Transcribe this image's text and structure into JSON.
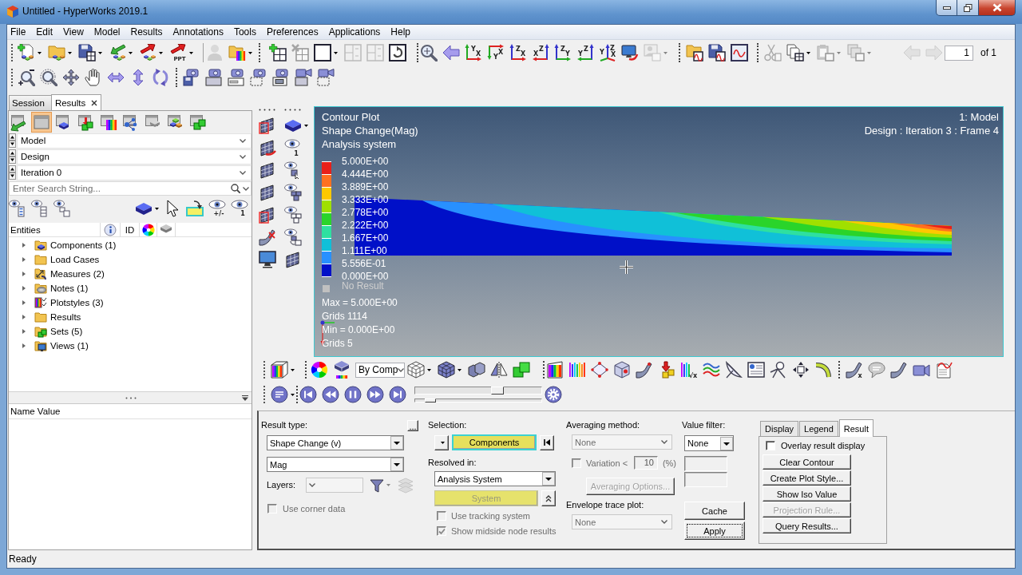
{
  "window": {
    "title": "Untitled - HyperWorks 2019.1"
  },
  "menu": [
    "File",
    "Edit",
    "View",
    "Model",
    "Results",
    "Annotations",
    "Tools",
    "Preferences",
    "Applications",
    "Help"
  ],
  "main_toolbar": {
    "row_1": [
      [
        {
          "disabled": false
        },
        {
          "disabled": false
        },
        {
          "disabled": false
        },
        {
          "disabled": false
        },
        {
          "disabled": false
        },
        {
          "disabled": false,
          "label": "PPT"
        }
      ],
      [
        {
          "disabled": true
        },
        {
          "disabled": false
        }
      ],
      [
        {
          "disabled": false
        },
        {
          "disabled": true
        },
        {
          "disabled": false
        },
        {
          "disabled": true
        },
        {
          "disabled": true
        },
        {
          "disabled": false
        }
      ],
      [
        {
          "disabled": false
        },
        {
          "disabled": false
        },
        {
          "disabled": false,
          "axes": [
            "Y",
            "X"
          ]
        },
        {
          "disabled": false,
          "axes": [
            "X",
            "Y"
          ]
        },
        {
          "disabled": false,
          "axes": [
            "Z",
            "X"
          ]
        },
        {
          "disabled": false,
          "axes": [
            "X",
            "Z"
          ]
        },
        {
          "disabled": false,
          "axes": [
            "Z",
            "Y"
          ]
        },
        {
          "disabled": false,
          "axes": [
            "Y",
            "Z"
          ]
        },
        {
          "disabled": false,
          "axes": [
            "Y",
            "Z",
            "X"
          ]
        },
        {
          "disabled": false
        },
        {
          "disabled": true
        }
      ],
      [
        {
          "disabled": false
        },
        {
          "disabled": false
        },
        {
          "disabled": false
        }
      ],
      [
        {
          "disabled": true
        },
        {
          "disabled": false
        },
        {
          "disabled": true
        },
        {
          "disabled": true
        }
      ]
    ],
    "page_nav": [
      {
        "disabled": true
      },
      {
        "disabled": true
      }
    ],
    "page": {
      "value": "1",
      "total": "of 1"
    },
    "row_2": [
      [
        {
          "disabled": false
        },
        {
          "disabled": false
        },
        {
          "disabled": false
        },
        {
          "disabled": false
        },
        {
          "disabled": false
        },
        {
          "disabled": false
        },
        {
          "disabled": false
        }
      ],
      [
        {
          "disabled": false
        },
        {
          "disabled": false
        },
        {
          "disabled": false
        },
        {
          "disabled": false
        },
        {
          "disabled": false
        },
        {
          "disabled": false
        },
        {
          "disabled": false
        }
      ]
    ]
  },
  "browser": {
    "tabs": [
      {
        "label": "Session",
        "selected": false,
        "closable": false
      },
      {
        "label": "Results",
        "selected": true,
        "closable": true
      }
    ],
    "tools": [
      {
        "selected": false
      },
      {
        "selected": true
      },
      {
        "selected": false
      },
      {
        "selected": false
      },
      {
        "selected": false
      },
      {
        "selected": false
      },
      {
        "selected": false
      },
      {
        "selected": false
      },
      {
        "selected": false
      }
    ],
    "selectors": [
      {
        "value": "Model"
      },
      {
        "value": "Design"
      },
      {
        "value": "Iteration 0"
      }
    ],
    "search": {
      "placeholder": "Enter Search String..."
    },
    "filter_tools": {
      "toggle_badge": "+/-",
      "single_badge": "1"
    },
    "columns": [
      {
        "kind": "text",
        "label": "Entities"
      },
      {
        "kind": "icon"
      },
      {
        "kind": "text",
        "label": "ID"
      },
      {
        "kind": "icon"
      },
      {
        "kind": "icon"
      }
    ],
    "tree": [
      {
        "label": "Components (1)",
        "expanded": false
      },
      {
        "label": "Load Cases",
        "expanded": false
      },
      {
        "label": "Measures (2)",
        "expanded": false
      },
      {
        "label": "Notes (1)",
        "expanded": false
      },
      {
        "label": "Plotstyles (3)",
        "expanded": false
      },
      {
        "label": "Results",
        "expanded": false
      },
      {
        "label": "Sets (5)",
        "expanded": false
      },
      {
        "label": "Views (1)",
        "expanded": false
      }
    ],
    "properties": {
      "header": "Name Value"
    }
  },
  "view_tools": {
    "eye_badge": "1"
  },
  "viewport": {
    "title_lines": [
      "Contour Plot",
      "Shape Change(Mag)",
      "Analysis system"
    ],
    "model_label": "1: Model",
    "frame_label": "Design : Iteration 3 : Frame 4",
    "legend": {
      "labels": [
        "5.000E+00",
        "4.444E+00",
        "3.889E+00",
        "3.333E+00",
        "2.778E+00",
        "2.222E+00",
        "1.667E+00",
        "1.111E+00",
        "5.556E-01",
        "0.000E+00"
      ],
      "bands": [
        {
          "color": "#e8201a"
        },
        {
          "color": "#ff7020"
        },
        {
          "color": "#ffc800"
        },
        {
          "color": "#a0e000"
        },
        {
          "color": "#2ad42a"
        },
        {
          "color": "#2ee0a0"
        },
        {
          "color": "#10c0d8"
        },
        {
          "color": "#2890ff"
        },
        {
          "color": "#0010c8"
        }
      ],
      "no_result": "No Result"
    },
    "stats": [
      "Max = 5.000E+00",
      "Grids 1114",
      "Min = 0.000E+00",
      "Grids 5"
    ]
  },
  "display_toolbar": {
    "color_mode": "By Comp",
    "sqrt_badge": "√x",
    "ramp_badge": "x"
  },
  "animation": {
    "frame_slider": {
      "level": 0.67
    },
    "speed_slider": {
      "level": 0.08
    }
  },
  "panel": {
    "result_type": {
      "label": "Result type:",
      "more": "...",
      "type": "Shape Change (v)",
      "component": "Mag"
    },
    "layers": {
      "label": "Layers:",
      "disabled": true
    },
    "corner_data": {
      "label": "Use corner data",
      "checked": false,
      "disabled": true
    },
    "selection": {
      "label": "Selection:",
      "target": "Components"
    },
    "resolved_in": {
      "label": "Resolved in:",
      "value": "Analysis System",
      "system": {
        "label": "System",
        "disabled": true
      }
    },
    "tracking": {
      "label": "Use tracking system",
      "checked": false,
      "disabled": true
    },
    "midside": {
      "label": "Show midside node results",
      "checked": true,
      "disabled": true
    },
    "averaging": {
      "label": "Averaging method:",
      "value": "None",
      "disabled": true
    },
    "variation": {
      "label": "Variation <",
      "value": "10",
      "unit": "(%)",
      "checked": false,
      "disabled": true
    },
    "averaging_options": {
      "label": "Averaging Options...",
      "disabled": true
    },
    "envelope": {
      "label": "Envelope trace plot:",
      "value": "None",
      "disabled": true
    },
    "value_filter": {
      "label": "Value filter:",
      "value": "None",
      "range_fields": [
        {
          "disabled": true
        },
        {
          "disabled": true
        }
      ]
    },
    "cache": "Cache",
    "apply": "Apply",
    "tabs": [
      {
        "label": "Display",
        "selected": false
      },
      {
        "label": "Legend",
        "selected": false
      },
      {
        "label": "Result",
        "selected": true
      }
    ],
    "overlay": {
      "label": "Overlay result display",
      "checked": false
    },
    "actions": [
      {
        "label": "Clear Contour",
        "disabled": false
      },
      {
        "label": "Create Plot Style...",
        "disabled": false
      },
      {
        "label": "Show Iso Value",
        "disabled": false
      },
      {
        "label": "Projection Rule...",
        "disabled": true
      },
      {
        "label": "Query Results...",
        "disabled": false
      }
    ]
  },
  "status_bar": "Ready"
}
